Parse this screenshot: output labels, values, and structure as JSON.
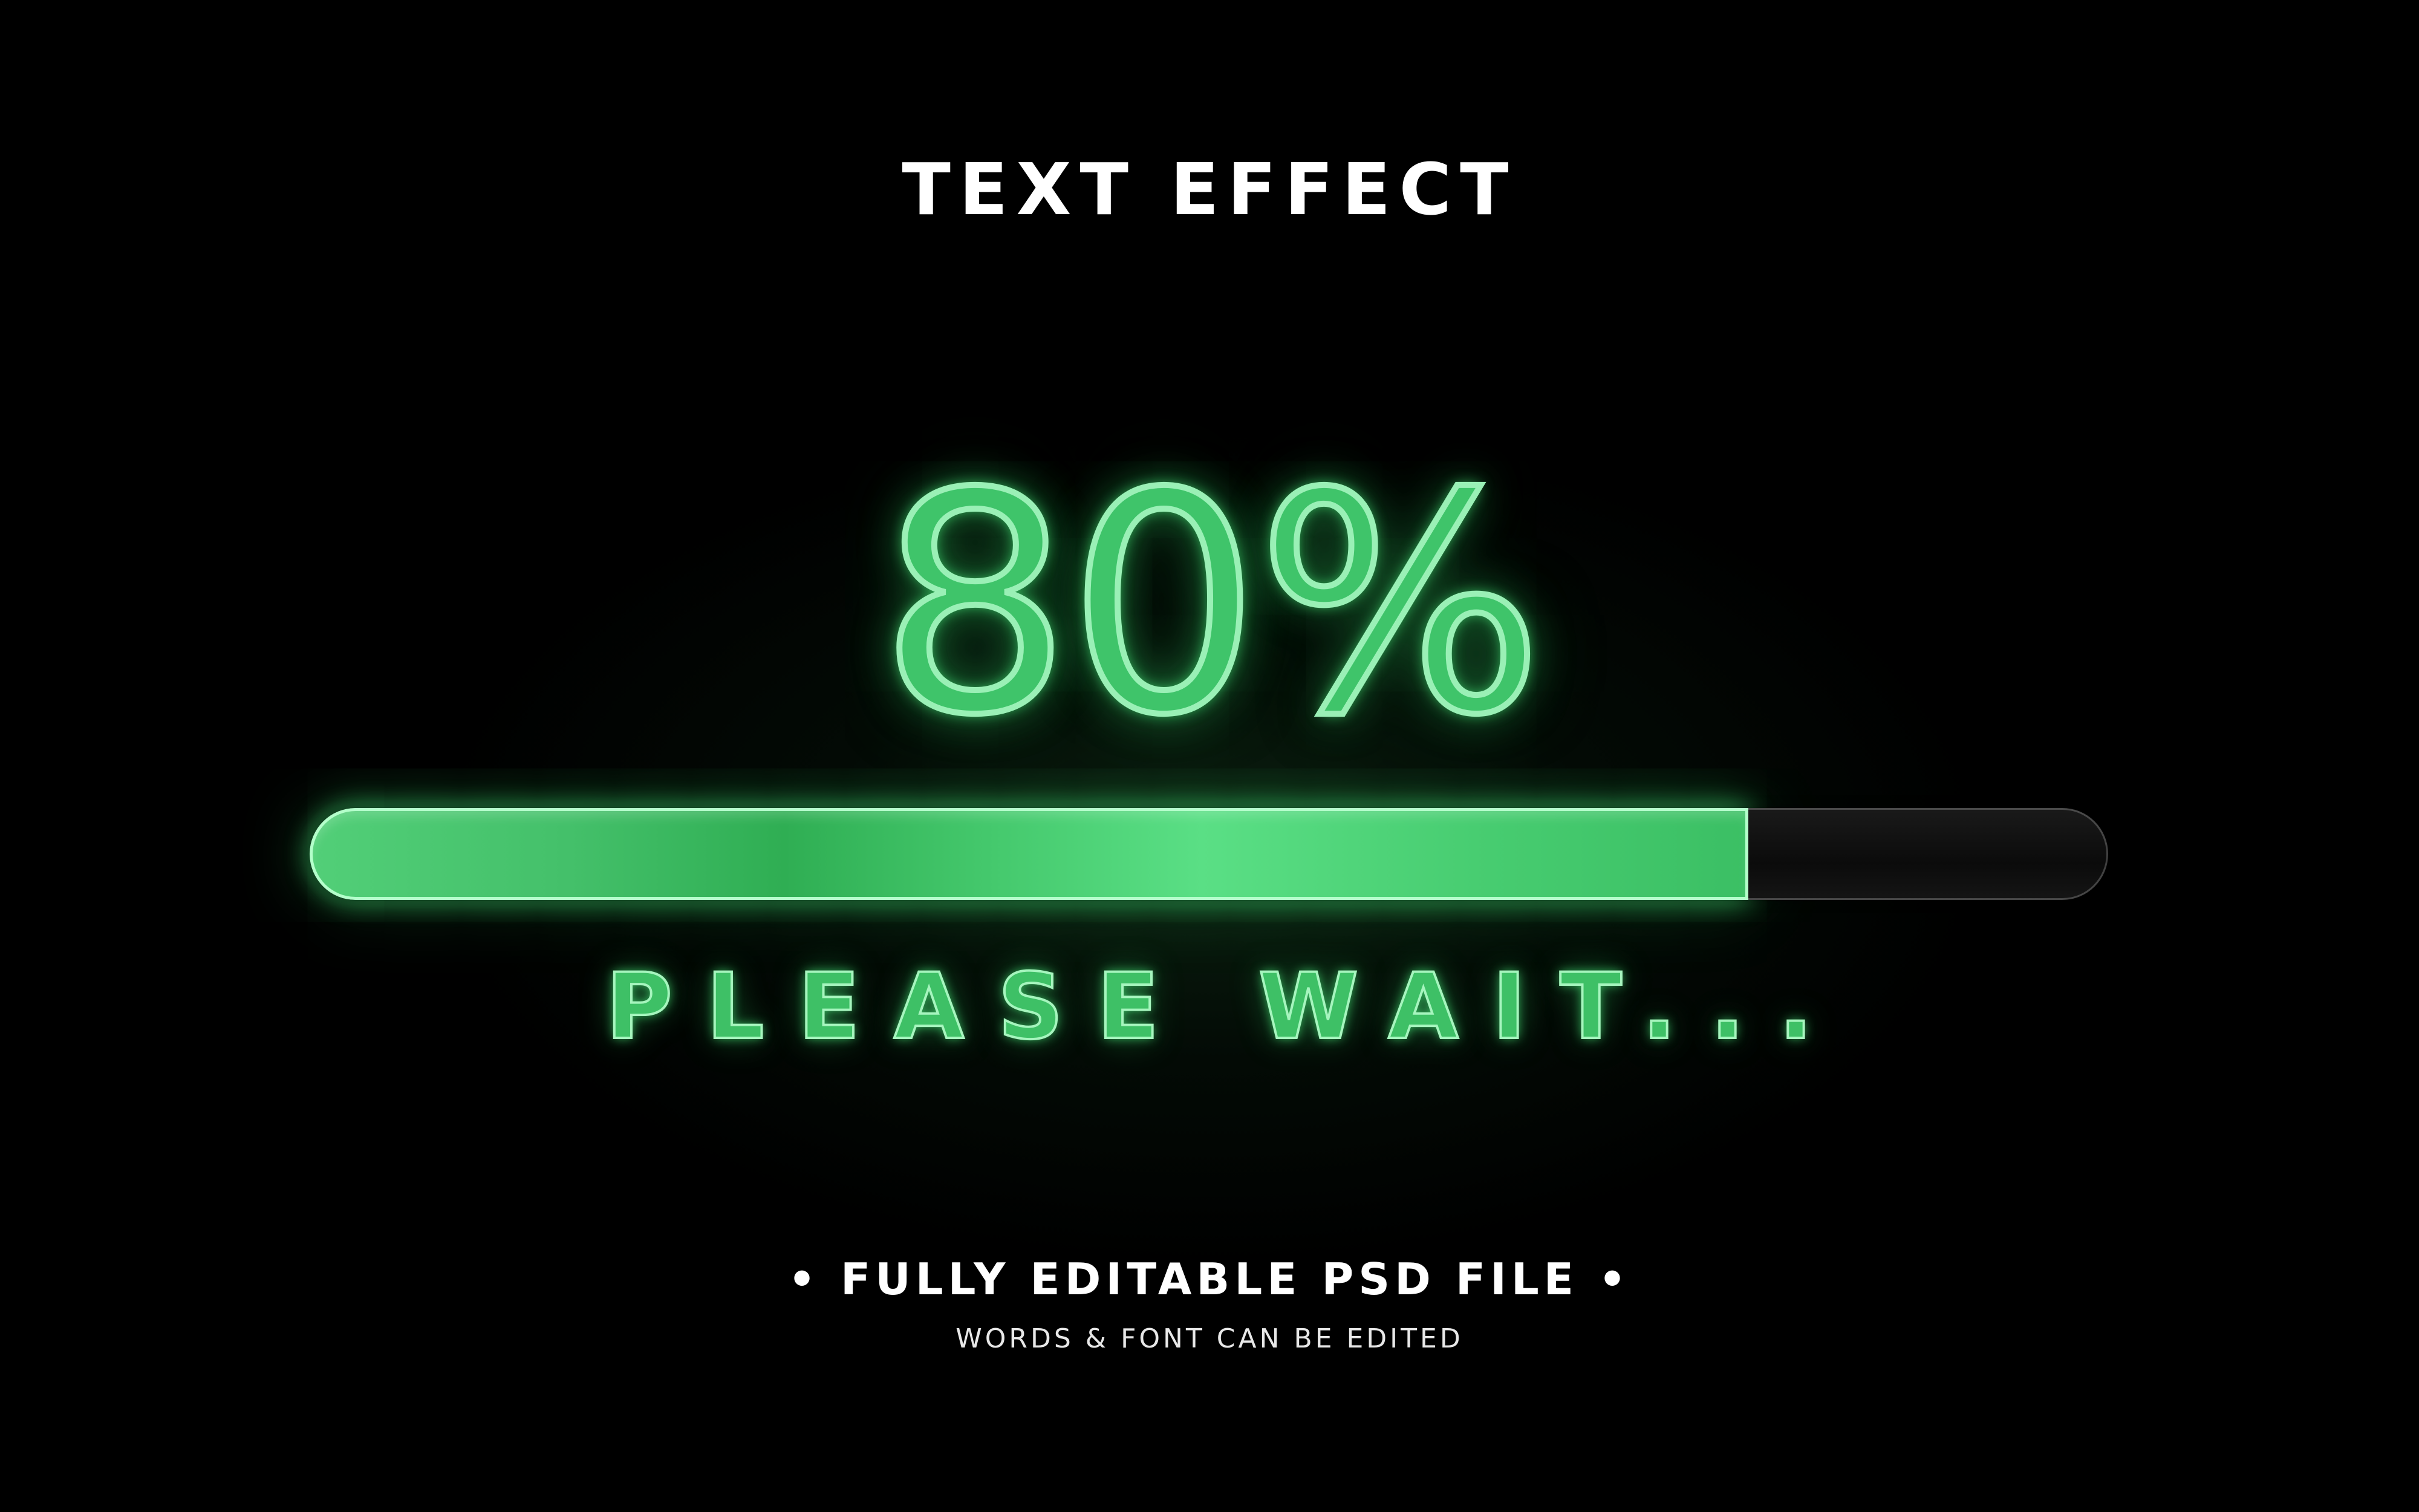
{
  "title": "TEXT EFFECT",
  "progress": {
    "label": "80%",
    "value": 0.8,
    "status_text": "PLEASE WAIT..."
  },
  "footer": {
    "subtitle": "• FULLY EDITABLE PSD FILE •",
    "caption": "WORDS & FONT CAN BE EDITED"
  },
  "colors": {
    "background": "#000000",
    "accent": "#3fc46a",
    "accent_light": "#9af0b6",
    "text": "#ffffff"
  }
}
